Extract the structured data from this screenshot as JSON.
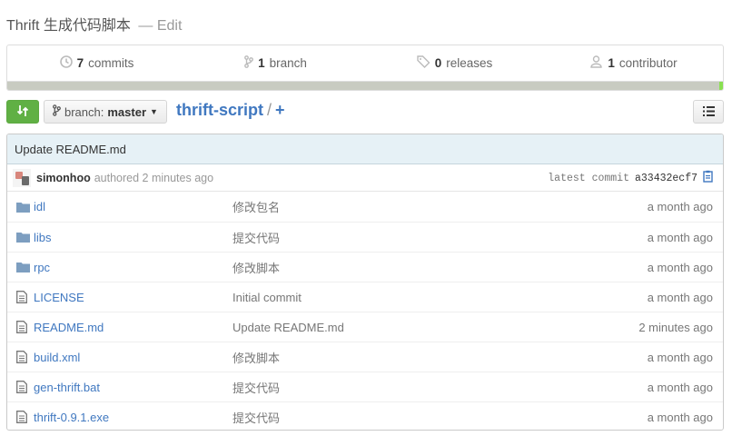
{
  "repo": {
    "description": "Thrift 生成代码脚本",
    "dash": "—",
    "edit_label": "Edit"
  },
  "summary": {
    "commits_count": "7",
    "commits_label": "commits",
    "branches_count": "1",
    "branches_label": "branch",
    "releases_count": "0",
    "releases_label": "releases",
    "contributors_count": "1",
    "contributors_label": "contributor"
  },
  "toolbar": {
    "branch_prefix": "branch:",
    "branch_name": "master",
    "repo_name": "thrift-script",
    "separator": "/",
    "plus": "+"
  },
  "commit": {
    "message": "Update README.md",
    "author": "simonhoo",
    "authored_text": "authored 2 minutes ago",
    "latest_label": "latest commit",
    "sha": "a33432ecf7"
  },
  "files": [
    {
      "type": "folder",
      "name": "idl",
      "message": "修改包名",
      "age": "a month ago"
    },
    {
      "type": "folder",
      "name": "libs",
      "message": "提交代码",
      "age": "a month ago"
    },
    {
      "type": "folder",
      "name": "rpc",
      "message": "修改脚本",
      "age": "a month ago"
    },
    {
      "type": "file",
      "name": "LICENSE",
      "message": "Initial commit",
      "age": "a month ago"
    },
    {
      "type": "file",
      "name": "README.md",
      "message": "Update README.md",
      "age": "2 minutes ago"
    },
    {
      "type": "file",
      "name": "build.xml",
      "message": "修改脚本",
      "age": "a month ago"
    },
    {
      "type": "file",
      "name": "gen-thrift.bat",
      "message": "提交代码",
      "age": "a month ago"
    },
    {
      "type": "file",
      "name": "thrift-0.9.1.exe",
      "message": "提交代码",
      "age": "a month ago"
    }
  ],
  "colors": {
    "link": "#4078c0",
    "compare_button": "#60b044",
    "commit_header": "#e6f1f6"
  },
  "icons": {
    "commits": "history-icon",
    "branches": "branch-icon",
    "releases": "tag-icon",
    "contributors": "organization-icon",
    "compare": "compare-icon",
    "list": "list-unordered-icon",
    "copy": "clippy-icon"
  }
}
